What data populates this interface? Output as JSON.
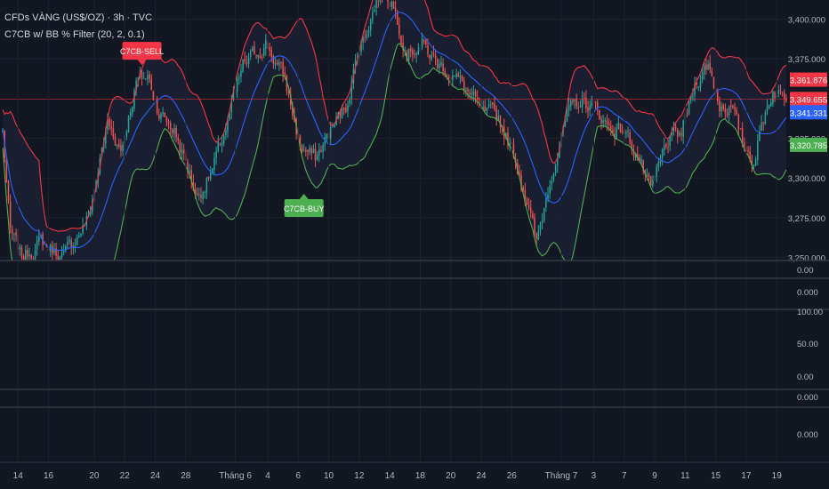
{
  "header": {
    "symbol": "CFDs VÀNG (US$/OZ) · 3h · TVC",
    "indicator": "C7CB w/ BB % Filter (20, 2, 0.1)"
  },
  "colors": {
    "background": "#131722",
    "up": "#26a69a",
    "down": "#ef5350",
    "band_upper": "#f23645",
    "band_lower": "#4caf50",
    "basis": "#2962ff",
    "band_fill": "#1b2033",
    "grid": "#1e222d",
    "separator": "#363a45",
    "sell_label": "#f23645",
    "buy_label": "#4caf50"
  },
  "signals": {
    "sell": "C7CB-SELL",
    "buy": "C7CB-BUY"
  },
  "chart_data": {
    "type": "candlestick",
    "title": "CFDs VÀNG (US$/OZ) · 3h · TVC",
    "y_ticks": [
      "3,400.000",
      "3,375.000",
      "3,325.000",
      "3,300.000",
      "3,275.000",
      "3,250.000"
    ],
    "y_tick_values": [
      3400,
      3375,
      3325,
      3300,
      3275,
      3250
    ],
    "ylim": [
      3248,
      3412
    ],
    "x_labels": [
      "14",
      "16",
      "20",
      "22",
      "24",
      "28",
      "Tháng 6",
      "4",
      "6",
      "10",
      "12",
      "14",
      "18",
      "20",
      "24",
      "26",
      "Tháng 7",
      "3",
      "7",
      "9",
      "11",
      "15",
      "17",
      "19"
    ],
    "x_label_index": [
      8,
      24,
      48,
      64,
      80,
      96,
      122,
      139,
      155,
      171,
      187,
      203,
      219,
      235,
      251,
      267,
      293,
      310,
      326,
      342,
      358,
      374,
      390,
      406
    ],
    "price_labels": [
      {
        "text": "3,361.876",
        "value": 3361.876,
        "color": "#f23645"
      },
      {
        "text": "3,349.655",
        "value": 3349.655,
        "color": "#f23645"
      },
      {
        "text": "3,341.331",
        "value": 3341.331,
        "color": "#2962ff"
      },
      {
        "text": "3,320.785",
        "value": 3320.785,
        "color": "#4caf50"
      }
    ],
    "horizontal_line": 3349.655,
    "anchors": [
      {
        "i": 0,
        "p": 3330
      },
      {
        "i": 4,
        "p": 3265
      },
      {
        "i": 10,
        "p": 3250
      },
      {
        "i": 20,
        "p": 3260
      },
      {
        "i": 32,
        "p": 3250
      },
      {
        "i": 45,
        "p": 3275
      },
      {
        "i": 55,
        "p": 3335
      },
      {
        "i": 62,
        "p": 3318
      },
      {
        "i": 70,
        "p": 3360
      },
      {
        "i": 76,
        "p": 3364
      },
      {
        "i": 82,
        "p": 3342
      },
      {
        "i": 90,
        "p": 3330
      },
      {
        "i": 96,
        "p": 3310
      },
      {
        "i": 102,
        "p": 3288
      },
      {
        "i": 110,
        "p": 3305
      },
      {
        "i": 118,
        "p": 3335
      },
      {
        "i": 126,
        "p": 3370
      },
      {
        "i": 138,
        "p": 3385
      },
      {
        "i": 148,
        "p": 3362
      },
      {
        "i": 156,
        "p": 3320
      },
      {
        "i": 164,
        "p": 3312
      },
      {
        "i": 172,
        "p": 3330
      },
      {
        "i": 180,
        "p": 3345
      },
      {
        "i": 186,
        "p": 3378
      },
      {
        "i": 192,
        "p": 3398
      },
      {
        "i": 198,
        "p": 3418
      },
      {
        "i": 204,
        "p": 3412
      },
      {
        "i": 212,
        "p": 3380
      },
      {
        "i": 220,
        "p": 3384
      },
      {
        "i": 228,
        "p": 3372
      },
      {
        "i": 236,
        "p": 3366
      },
      {
        "i": 244,
        "p": 3354
      },
      {
        "i": 252,
        "p": 3340
      },
      {
        "i": 260,
        "p": 3338
      },
      {
        "i": 268,
        "p": 3315
      },
      {
        "i": 274,
        "p": 3292
      },
      {
        "i": 280,
        "p": 3258
      },
      {
        "i": 288,
        "p": 3305
      },
      {
        "i": 296,
        "p": 3338
      },
      {
        "i": 302,
        "p": 3348
      },
      {
        "i": 310,
        "p": 3345
      },
      {
        "i": 318,
        "p": 3332
      },
      {
        "i": 326,
        "p": 3330
      },
      {
        "i": 334,
        "p": 3312
      },
      {
        "i": 340,
        "p": 3290
      },
      {
        "i": 348,
        "p": 3322
      },
      {
        "i": 356,
        "p": 3328
      },
      {
        "i": 364,
        "p": 3362
      },
      {
        "i": 370,
        "p": 3372
      },
      {
        "i": 376,
        "p": 3346
      },
      {
        "i": 382,
        "p": 3345
      },
      {
        "i": 388,
        "p": 3322
      },
      {
        "i": 394,
        "p": 3312
      },
      {
        "i": 400,
        "p": 3342
      },
      {
        "i": 404,
        "p": 3356
      },
      {
        "i": 408,
        "p": 3352
      }
    ],
    "bb_length": 20,
    "bb_mult": 2,
    "bb_filter": 0.1,
    "sell_signal_index": 73,
    "buy_signal_index": 158,
    "sub_panes": [
      {
        "name": "pane-1",
        "ticks": [
          "0.00"
        ]
      },
      {
        "name": "pane-2",
        "ticks": [
          "0.000"
        ]
      },
      {
        "name": "pane-3",
        "ticks": [
          "100.00",
          "50.00",
          "0.00"
        ]
      },
      {
        "name": "pane-4",
        "ticks": [
          "0.000"
        ]
      },
      {
        "name": "pane-5",
        "ticks": [
          "0.000"
        ]
      }
    ]
  }
}
